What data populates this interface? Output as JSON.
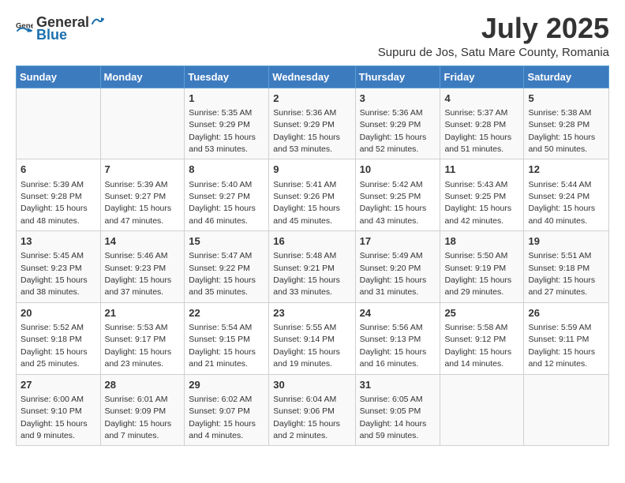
{
  "logo": {
    "text_general": "General",
    "text_blue": "Blue"
  },
  "title": "July 2025",
  "subtitle": "Supuru de Jos, Satu Mare County, Romania",
  "weekdays": [
    "Sunday",
    "Monday",
    "Tuesday",
    "Wednesday",
    "Thursday",
    "Friday",
    "Saturday"
  ],
  "weeks": [
    [
      {
        "day": "",
        "sunrise": "",
        "sunset": "",
        "daylight": ""
      },
      {
        "day": "",
        "sunrise": "",
        "sunset": "",
        "daylight": ""
      },
      {
        "day": "1",
        "sunrise": "Sunrise: 5:35 AM",
        "sunset": "Sunset: 9:29 PM",
        "daylight": "Daylight: 15 hours and 53 minutes."
      },
      {
        "day": "2",
        "sunrise": "Sunrise: 5:36 AM",
        "sunset": "Sunset: 9:29 PM",
        "daylight": "Daylight: 15 hours and 53 minutes."
      },
      {
        "day": "3",
        "sunrise": "Sunrise: 5:36 AM",
        "sunset": "Sunset: 9:29 PM",
        "daylight": "Daylight: 15 hours and 52 minutes."
      },
      {
        "day": "4",
        "sunrise": "Sunrise: 5:37 AM",
        "sunset": "Sunset: 9:28 PM",
        "daylight": "Daylight: 15 hours and 51 minutes."
      },
      {
        "day": "5",
        "sunrise": "Sunrise: 5:38 AM",
        "sunset": "Sunset: 9:28 PM",
        "daylight": "Daylight: 15 hours and 50 minutes."
      }
    ],
    [
      {
        "day": "6",
        "sunrise": "Sunrise: 5:39 AM",
        "sunset": "Sunset: 9:28 PM",
        "daylight": "Daylight: 15 hours and 48 minutes."
      },
      {
        "day": "7",
        "sunrise": "Sunrise: 5:39 AM",
        "sunset": "Sunset: 9:27 PM",
        "daylight": "Daylight: 15 hours and 47 minutes."
      },
      {
        "day": "8",
        "sunrise": "Sunrise: 5:40 AM",
        "sunset": "Sunset: 9:27 PM",
        "daylight": "Daylight: 15 hours and 46 minutes."
      },
      {
        "day": "9",
        "sunrise": "Sunrise: 5:41 AM",
        "sunset": "Sunset: 9:26 PM",
        "daylight": "Daylight: 15 hours and 45 minutes."
      },
      {
        "day": "10",
        "sunrise": "Sunrise: 5:42 AM",
        "sunset": "Sunset: 9:25 PM",
        "daylight": "Daylight: 15 hours and 43 minutes."
      },
      {
        "day": "11",
        "sunrise": "Sunrise: 5:43 AM",
        "sunset": "Sunset: 9:25 PM",
        "daylight": "Daylight: 15 hours and 42 minutes."
      },
      {
        "day": "12",
        "sunrise": "Sunrise: 5:44 AM",
        "sunset": "Sunset: 9:24 PM",
        "daylight": "Daylight: 15 hours and 40 minutes."
      }
    ],
    [
      {
        "day": "13",
        "sunrise": "Sunrise: 5:45 AM",
        "sunset": "Sunset: 9:23 PM",
        "daylight": "Daylight: 15 hours and 38 minutes."
      },
      {
        "day": "14",
        "sunrise": "Sunrise: 5:46 AM",
        "sunset": "Sunset: 9:23 PM",
        "daylight": "Daylight: 15 hours and 37 minutes."
      },
      {
        "day": "15",
        "sunrise": "Sunrise: 5:47 AM",
        "sunset": "Sunset: 9:22 PM",
        "daylight": "Daylight: 15 hours and 35 minutes."
      },
      {
        "day": "16",
        "sunrise": "Sunrise: 5:48 AM",
        "sunset": "Sunset: 9:21 PM",
        "daylight": "Daylight: 15 hours and 33 minutes."
      },
      {
        "day": "17",
        "sunrise": "Sunrise: 5:49 AM",
        "sunset": "Sunset: 9:20 PM",
        "daylight": "Daylight: 15 hours and 31 minutes."
      },
      {
        "day": "18",
        "sunrise": "Sunrise: 5:50 AM",
        "sunset": "Sunset: 9:19 PM",
        "daylight": "Daylight: 15 hours and 29 minutes."
      },
      {
        "day": "19",
        "sunrise": "Sunrise: 5:51 AM",
        "sunset": "Sunset: 9:18 PM",
        "daylight": "Daylight: 15 hours and 27 minutes."
      }
    ],
    [
      {
        "day": "20",
        "sunrise": "Sunrise: 5:52 AM",
        "sunset": "Sunset: 9:18 PM",
        "daylight": "Daylight: 15 hours and 25 minutes."
      },
      {
        "day": "21",
        "sunrise": "Sunrise: 5:53 AM",
        "sunset": "Sunset: 9:17 PM",
        "daylight": "Daylight: 15 hours and 23 minutes."
      },
      {
        "day": "22",
        "sunrise": "Sunrise: 5:54 AM",
        "sunset": "Sunset: 9:15 PM",
        "daylight": "Daylight: 15 hours and 21 minutes."
      },
      {
        "day": "23",
        "sunrise": "Sunrise: 5:55 AM",
        "sunset": "Sunset: 9:14 PM",
        "daylight": "Daylight: 15 hours and 19 minutes."
      },
      {
        "day": "24",
        "sunrise": "Sunrise: 5:56 AM",
        "sunset": "Sunset: 9:13 PM",
        "daylight": "Daylight: 15 hours and 16 minutes."
      },
      {
        "day": "25",
        "sunrise": "Sunrise: 5:58 AM",
        "sunset": "Sunset: 9:12 PM",
        "daylight": "Daylight: 15 hours and 14 minutes."
      },
      {
        "day": "26",
        "sunrise": "Sunrise: 5:59 AM",
        "sunset": "Sunset: 9:11 PM",
        "daylight": "Daylight: 15 hours and 12 minutes."
      }
    ],
    [
      {
        "day": "27",
        "sunrise": "Sunrise: 6:00 AM",
        "sunset": "Sunset: 9:10 PM",
        "daylight": "Daylight: 15 hours and 9 minutes."
      },
      {
        "day": "28",
        "sunrise": "Sunrise: 6:01 AM",
        "sunset": "Sunset: 9:09 PM",
        "daylight": "Daylight: 15 hours and 7 minutes."
      },
      {
        "day": "29",
        "sunrise": "Sunrise: 6:02 AM",
        "sunset": "Sunset: 9:07 PM",
        "daylight": "Daylight: 15 hours and 4 minutes."
      },
      {
        "day": "30",
        "sunrise": "Sunrise: 6:04 AM",
        "sunset": "Sunset: 9:06 PM",
        "daylight": "Daylight: 15 hours and 2 minutes."
      },
      {
        "day": "31",
        "sunrise": "Sunrise: 6:05 AM",
        "sunset": "Sunset: 9:05 PM",
        "daylight": "Daylight: 14 hours and 59 minutes."
      },
      {
        "day": "",
        "sunrise": "",
        "sunset": "",
        "daylight": ""
      },
      {
        "day": "",
        "sunrise": "",
        "sunset": "",
        "daylight": ""
      }
    ]
  ]
}
